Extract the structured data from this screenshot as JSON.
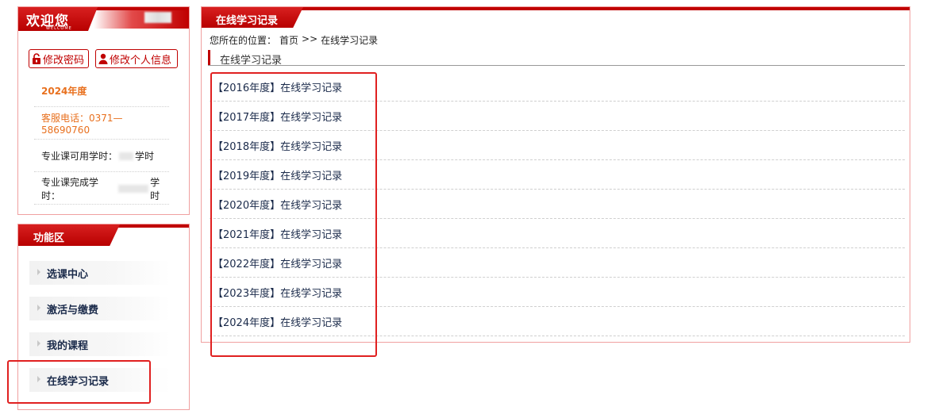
{
  "welcome": {
    "title": "欢迎您",
    "subtitle": "WELCOME",
    "change_password": "修改密码",
    "edit_profile": "修改个人信息",
    "year": "2024年度",
    "phone": "客服电话：0371—58690760",
    "available_hours_label": "专业课可用学时：",
    "available_hours_unit": "学时",
    "completed_hours_label": "专业课完成学时：",
    "completed_hours_unit": "学时"
  },
  "func": {
    "title": "功能区",
    "items": [
      {
        "label": "选课中心"
      },
      {
        "label": "激活与缴费"
      },
      {
        "label": "我的课程"
      },
      {
        "label": "在线学习记录"
      }
    ]
  },
  "main": {
    "title": "在线学习记录",
    "breadcrumb": {
      "prefix": "您所在的位置：",
      "home": "首页",
      "separator": ">>",
      "current": "在线学习记录"
    },
    "section_title": "在线学习记录",
    "records": [
      {
        "label": "【2016年度】在线学习记录"
      },
      {
        "label": "【2017年度】在线学习记录"
      },
      {
        "label": "【2018年度】在线学习记录"
      },
      {
        "label": "【2019年度】在线学习记录"
      },
      {
        "label": "【2020年度】在线学习记录"
      },
      {
        "label": "【2021年度】在线学习记录"
      },
      {
        "label": "【2022年度】在线学习记录"
      },
      {
        "label": "【2023年度】在线学习记录"
      },
      {
        "label": "【2024年度】在线学习记录"
      }
    ]
  },
  "colors": {
    "brand_red": "#c00000",
    "accent_orange": "#e8701e",
    "highlight_red": "#e02020"
  },
  "icons": {
    "lock": "lock-icon",
    "user": "user-icon",
    "arrow": "triangle-right-icon"
  }
}
